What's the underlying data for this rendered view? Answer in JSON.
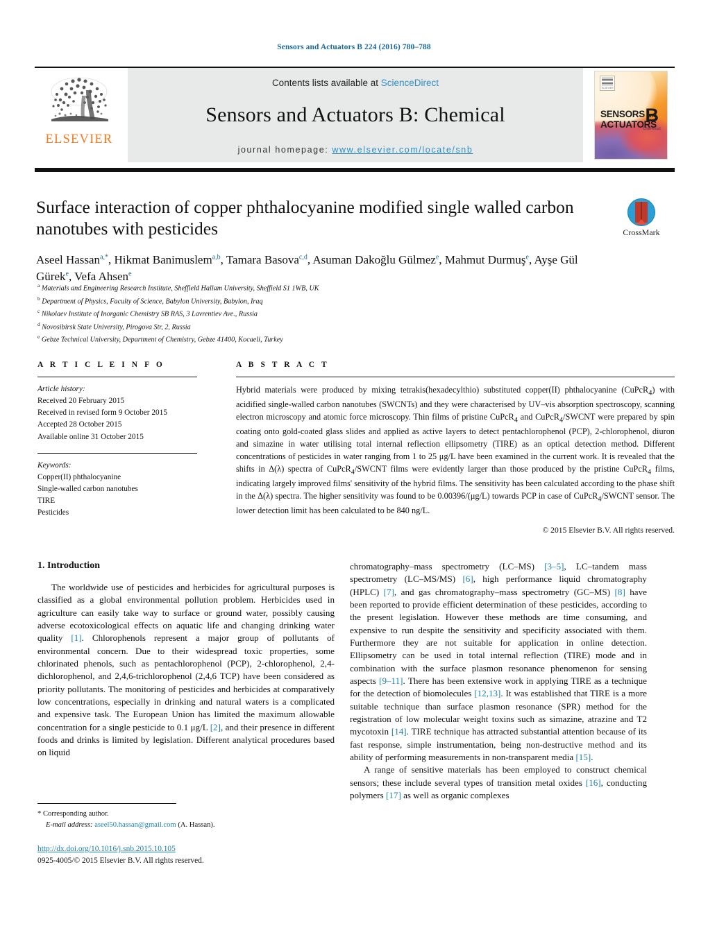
{
  "running_head": "Sensors and Actuators B 224 (2016) 780–788",
  "masthead": {
    "contents_prefix": "Contents lists available at ",
    "sciencedirect": "ScienceDirect",
    "journal_title": "Sensors and Actuators B: Chemical",
    "homepage_label": "journal homepage:",
    "homepage_url": "www.elsevier.com/locate/snb",
    "publisher_wordmark": "ELSEVIER",
    "publisher_color": "#F47B20",
    "link_color": "#2d8fc9",
    "cover": {
      "line1": "SENSORS",
      "line1_small": "and",
      "line2": "ACTUATORS",
      "letter": "B",
      "sub": "Chemical"
    }
  },
  "article": {
    "title": "Surface interaction of copper phthalocyanine modified single walled carbon nanotubes with pesticides",
    "authors_html": "Aseel Hassan<sup class=\"aff star\">a,*</sup>, Hikmat Banimuslem<sup class=\"aff\">a,b</sup>, Tamara Basova<sup class=\"aff\">c,d</sup>, Asuman Dakoğlu Gülmez<sup class=\"aff\">e</sup>, Mahmut Durmuş<sup class=\"aff\">e</sup>, Ayşe Gül Gürek<sup class=\"aff\">e</sup>, Vefa Ahsen<sup class=\"aff\">e</sup>",
    "affiliations": [
      {
        "marker": "a",
        "text": "Materials and Engineering Research Institute, Sheffield Hallam University, Sheffield S1 1WB, UK"
      },
      {
        "marker": "b",
        "text": "Department of Physics, Faculty of Science, Babylon University, Babylon, Iraq"
      },
      {
        "marker": "c",
        "text": "Nikolaev Institute of Inorganic Chemistry SB RAS, 3 Lavrentiev Ave., Russia"
      },
      {
        "marker": "d",
        "text": "Novosibirsk State University, Pirogova Str, 2, Russia"
      },
      {
        "marker": "e",
        "text": "Gebze Technical University, Department of Chemistry, Gebze 41400, Kocaeli, Turkey"
      }
    ],
    "crossmark_label": "CrossMark"
  },
  "article_info": {
    "heading": "A R T I C L E   I N F O",
    "history_label": "Article history:",
    "history": [
      "Received 20 February 2015",
      "Received in revised form 9 October 2015",
      "Accepted 28 October 2015",
      "Available online 31 October 2015"
    ],
    "keywords_label": "Keywords:",
    "keywords": [
      "Copper(II) phthalocyanine",
      "Single-walled carbon nanotubes",
      "TIRE",
      "Pesticides"
    ]
  },
  "abstract": {
    "heading": "A B S T R A C T",
    "text_html": "Hybrid materials were produced by mixing tetrakis(hexadecylthio) substituted copper(II) phthalocyanine (CuPcR<sub>4</sub>) with acidified single-walled carbon nanotubes (SWCNTs) and they were characterised by UV–vis absorption spectroscopy, scanning electron microscopy and atomic force microscopy. Thin films of pristine CuPcR<sub>4</sub> and CuPcR<sub>4</sub>/SWCNT were prepared by spin coating onto gold-coated glass slides and applied as active layers to detect pentachlorophenol (PCP), 2-chlorophenol, diuron and simazine in water utilising total internal reflection ellipsometry (TIRE) as an optical detection method. Different concentrations of pesticides in water ranging from 1 to 25 μg/L have been examined in the current work. It is revealed that the shifts in Δ(λ) spectra of CuPcR<sub>4</sub>/SWCNT films were evidently larger than those produced by the pristine CuPcR<sub>4</sub> films, indicating largely improved films' sensitivity of the hybrid films. The sensitivity has been calculated according to the phase shift in the Δ(λ) spectra. The higher sensitivity was found to be 0.00396/(μg/L) towards PCP in case of CuPcR<sub>4</sub>/SWCNT sensor. The lower detection limit has been calculated to be 840 ng/L.",
    "copyright": "© 2015 Elsevier B.V. All rights reserved."
  },
  "body": {
    "section_title": "1.  Introduction",
    "left_paragraph_html": "The worldwide use of pesticides and herbicides for agricultural purposes is classified as a global environmental pollution problem. Herbicides used in agriculture can easily take way to surface or ground water, possibly causing adverse ecotoxicological effects on aquatic life and changing drinking water quality <span class=\"ref\">[1]</span>. Chlorophenols represent a major group of pollutants of environmental concern. Due to their widespread toxic properties, some chlorinated phenols, such as pentachlorophenol (PCP), 2-chlorophenol, 2,4-dichlorophenol, and 2,4,6-trichlorophenol (2,4,6 TCP) have been considered as priority pollutants. The monitoring of pesticides and herbicides at comparatively low concentrations, especially in drinking and natural waters is a complicated and expensive task. The European Union has limited the maximum allowable concentration for a single pesticide to 0.1 μg/L <span class=\"ref\">[2]</span>, and their presence in different foods and drinks is limited by legislation. Different analytical procedures based on liquid",
    "right_paragraph1_html": "chromatography–mass spectrometry (LC–MS) <span class=\"ref\">[3–5]</span>, LC–tandem mass spectrometry (LC–MS/MS) <span class=\"ref\">[6]</span>, high performance liquid chromatography (HPLC) <span class=\"ref\">[7]</span>, and gas chromatography–mass spectrometry (GC–MS) <span class=\"ref\">[8]</span> have been reported to provide efficient determination of these pesticides, according to the present legislation. However these methods are time consuming, and expensive to run despite the sensitivity and specificity associated with them. Furthermore they are not suitable for application in online detection. Ellipsometry can be used in total internal reflection (TIRE) mode and in combination with the surface plasmon resonance phenomenon for sensing aspects <span class=\"ref\">[9–11]</span>. There has been extensive work in applying TIRE as a technique for the detection of biomolecules <span class=\"ref\">[12,13]</span>. It was established that TIRE is a more suitable technique than surface plasmon resonance (SPR) method for the registration of low molecular weight toxins such as simazine, atrazine and T2 mycotoxin <span class=\"ref\">[14]</span>. TIRE technique has attracted substantial attention because of its fast response, simple instrumentation, being non-destructive method and its ability of performing measurements in non-transparent media <span class=\"ref\">[15]</span>.",
    "right_paragraph2_html": "A range of sensitive materials has been employed to construct chemical sensors; these include several types of transition metal oxides <span class=\"ref\">[16]</span>, conducting polymers <span class=\"ref\">[17]</span> as well as organic complexes"
  },
  "footer": {
    "corresponding_marker": "*",
    "corresponding_label": "Corresponding author.",
    "email_label": "E-mail address:",
    "email": "aseel50.hassan@gmail.com",
    "email_suffix": "(A. Hassan).",
    "doi_url": "http://dx.doi.org/10.1016/j.snb.2015.10.105",
    "issn_line": "0925-4005/© 2015 Elsevier B.V. All rights reserved."
  }
}
